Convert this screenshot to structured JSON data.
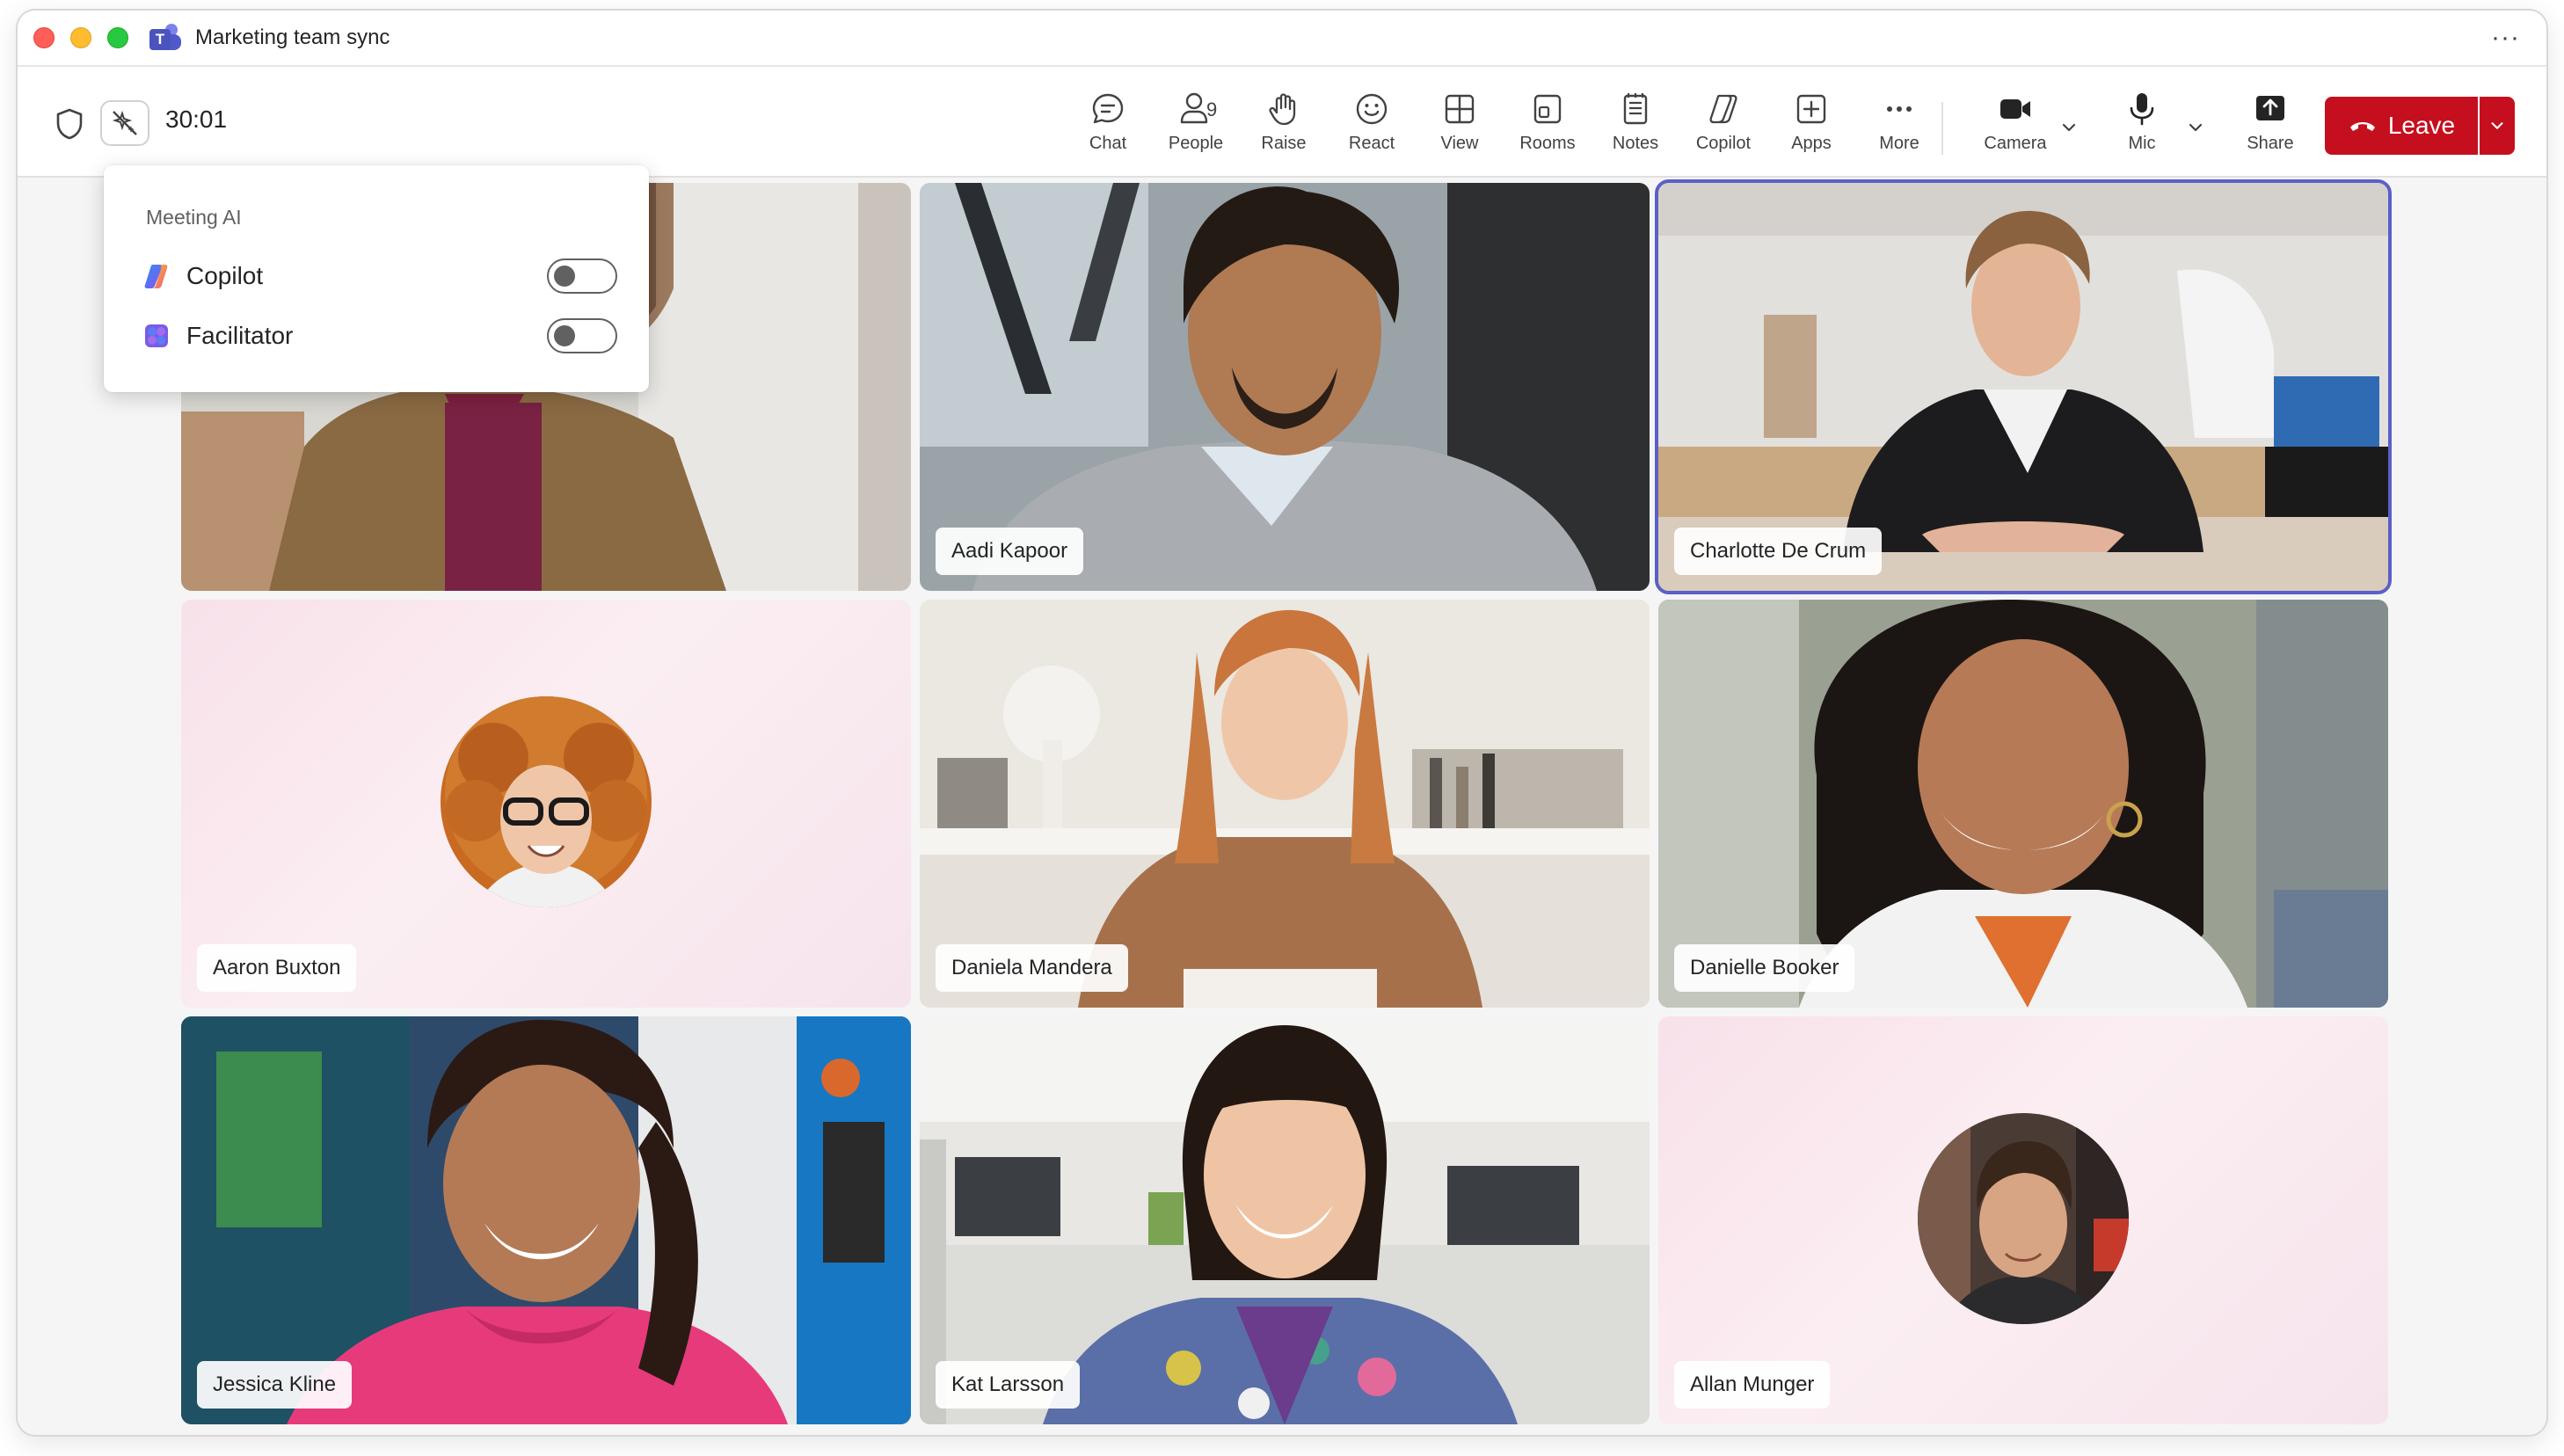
{
  "window": {
    "title": "Marketing team sync"
  },
  "toolbar": {
    "timer": "30:01",
    "people_count": "9",
    "items": [
      {
        "id": "chat",
        "label": "Chat"
      },
      {
        "id": "people",
        "label": "People"
      },
      {
        "id": "raise",
        "label": "Raise"
      },
      {
        "id": "react",
        "label": "React"
      },
      {
        "id": "view",
        "label": "View"
      },
      {
        "id": "rooms",
        "label": "Rooms"
      },
      {
        "id": "notes",
        "label": "Notes"
      },
      {
        "id": "copilot",
        "label": "Copilot"
      },
      {
        "id": "apps",
        "label": "Apps"
      },
      {
        "id": "more",
        "label": "More"
      },
      {
        "id": "camera",
        "label": "Camera"
      },
      {
        "id": "mic",
        "label": "Mic"
      },
      {
        "id": "share",
        "label": "Share"
      }
    ],
    "leave_label": "Leave"
  },
  "meeting_ai": {
    "title": "Meeting AI",
    "options": [
      {
        "label": "Copilot",
        "enabled": false
      },
      {
        "label": "Facilitator",
        "enabled": false
      }
    ]
  },
  "participants": [
    {
      "name": "",
      "type": "video"
    },
    {
      "name": "Aadi Kapoor",
      "type": "video"
    },
    {
      "name": "Charlotte De Crum",
      "type": "video",
      "active_speaker": true
    },
    {
      "name": "Aaron Buxton",
      "type": "avatar"
    },
    {
      "name": "Daniela Mandera",
      "type": "video"
    },
    {
      "name": "Danielle Booker",
      "type": "video"
    },
    {
      "name": "Jessica Kline",
      "type": "video"
    },
    {
      "name": "Kat Larsson",
      "type": "video"
    },
    {
      "name": "Allan Munger",
      "type": "avatar"
    }
  ],
  "colors": {
    "leave": "#c50f1f",
    "accent": "#5b5fc7"
  }
}
